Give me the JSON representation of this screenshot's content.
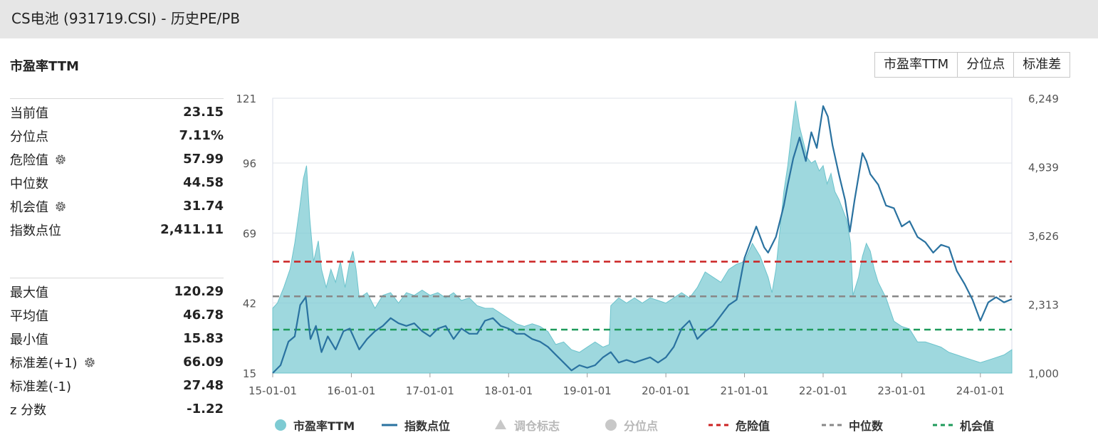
{
  "header": {
    "title": "CS电池 (931719.CSI) - 历史PE/PB"
  },
  "section": {
    "title": "市盈率TTM"
  },
  "tabs": [
    {
      "label": "市盈率TTM"
    },
    {
      "label": "分位点"
    },
    {
      "label": "标准差"
    }
  ],
  "stats_top": [
    {
      "label": "当前值",
      "value": "23.15",
      "gear": false
    },
    {
      "label": "分位点",
      "value": "7.11%",
      "gear": false
    },
    {
      "label": "危险值",
      "value": "57.99",
      "gear": true
    },
    {
      "label": "中位数",
      "value": "44.58",
      "gear": false
    },
    {
      "label": "机会值",
      "value": "31.74",
      "gear": true
    },
    {
      "label": "指数点位",
      "value": "2,411.11",
      "gear": false
    }
  ],
  "stats_bottom": [
    {
      "label": "最大值",
      "value": "120.29",
      "gear": false
    },
    {
      "label": "平均值",
      "value": "46.78",
      "gear": false
    },
    {
      "label": "最小值",
      "value": "15.83",
      "gear": false
    },
    {
      "label": "标准差(+1)",
      "value": "66.09",
      "gear": true
    },
    {
      "label": "标准差(-1)",
      "value": "27.48",
      "gear": false
    },
    {
      "label": "z 分数",
      "value": "-1.22",
      "gear": false
    }
  ],
  "legend": [
    {
      "label": "市盈率TTM",
      "marker": "circle",
      "color": "#7ecbd3",
      "active": true
    },
    {
      "label": "指数点位",
      "marker": "line",
      "color": "#2a72a0",
      "active": true
    },
    {
      "label": "调仓标志",
      "marker": "triangle",
      "color": "#c8c8c8",
      "active": false
    },
    {
      "label": "分位点",
      "marker": "circle",
      "color": "#c8c8c8",
      "active": false
    },
    {
      "label": "危险值",
      "marker": "dash",
      "color": "#cc2222",
      "active": true
    },
    {
      "label": "中位数",
      "marker": "dash",
      "color": "#888888",
      "active": true
    },
    {
      "label": "机会值",
      "marker": "dash",
      "color": "#1e9a5a",
      "active": true
    }
  ],
  "chart_data": {
    "type": "area",
    "x_tick_labels": [
      "15-01-01",
      "16-01-01",
      "17-01-01",
      "18-01-01",
      "19-01-01",
      "20-01-01",
      "21-01-01",
      "22-01-01",
      "23-01-01",
      "24-01-01"
    ],
    "y_left": {
      "ticks": [
        "121",
        "96",
        "69",
        "42",
        "15"
      ],
      "tick_values": [
        121,
        96,
        69,
        42,
        15
      ],
      "range": [
        15,
        121
      ]
    },
    "y_right": {
      "ticks": [
        "6,249",
        "4,939",
        "3,626",
        "2,313",
        "1,000"
      ],
      "tick_values": [
        6249,
        4939,
        3626,
        2313,
        1000
      ],
      "range": [
        1000,
        6249
      ]
    },
    "x_range": [
      2015.0,
      2024.4
    ],
    "reference_lines": [
      {
        "name": "危险值",
        "value": 57.99,
        "color": "#cc2222"
      },
      {
        "name": "中位数",
        "value": 44.58,
        "color": "#888888"
      },
      {
        "name": "机会值",
        "value": 31.74,
        "color": "#1e9a5a"
      }
    ],
    "series": [
      {
        "name": "市盈率TTM",
        "axis": "left",
        "kind": "area",
        "color": "#7ecbd3",
        "points": [
          [
            2015.0,
            40
          ],
          [
            2015.06,
            42
          ],
          [
            2015.14,
            48
          ],
          [
            2015.22,
            55
          ],
          [
            2015.28,
            65
          ],
          [
            2015.34,
            78
          ],
          [
            2015.39,
            90
          ],
          [
            2015.43,
            95
          ],
          [
            2015.47,
            75
          ],
          [
            2015.52,
            58
          ],
          [
            2015.58,
            66
          ],
          [
            2015.62,
            55
          ],
          [
            2015.68,
            48
          ],
          [
            2015.74,
            55
          ],
          [
            2015.8,
            50
          ],
          [
            2015.86,
            58
          ],
          [
            2015.92,
            48
          ],
          [
            2015.98,
            58
          ],
          [
            2016.02,
            62
          ],
          [
            2016.06,
            55
          ],
          [
            2016.1,
            44
          ],
          [
            2016.2,
            46
          ],
          [
            2016.3,
            40
          ],
          [
            2016.4,
            45
          ],
          [
            2016.5,
            46
          ],
          [
            2016.6,
            42
          ],
          [
            2016.7,
            46
          ],
          [
            2016.8,
            45
          ],
          [
            2016.9,
            47
          ],
          [
            2017.0,
            45
          ],
          [
            2017.1,
            46
          ],
          [
            2017.2,
            44
          ],
          [
            2017.3,
            46
          ],
          [
            2017.4,
            43
          ],
          [
            2017.5,
            44
          ],
          [
            2017.6,
            41
          ],
          [
            2017.7,
            40
          ],
          [
            2017.8,
            40
          ],
          [
            2017.9,
            38
          ],
          [
            2018.0,
            36
          ],
          [
            2018.1,
            34
          ],
          [
            2018.2,
            33
          ],
          [
            2018.3,
            34
          ],
          [
            2018.4,
            33
          ],
          [
            2018.5,
            31
          ],
          [
            2018.6,
            26
          ],
          [
            2018.7,
            27
          ],
          [
            2018.8,
            24
          ],
          [
            2018.9,
            23
          ],
          [
            2019.0,
            25
          ],
          [
            2019.1,
            27
          ],
          [
            2019.2,
            25
          ],
          [
            2019.28,
            26
          ],
          [
            2019.3,
            41
          ],
          [
            2019.4,
            44
          ],
          [
            2019.5,
            42
          ],
          [
            2019.6,
            44
          ],
          [
            2019.7,
            42
          ],
          [
            2019.8,
            44
          ],
          [
            2019.9,
            43
          ],
          [
            2020.0,
            42
          ],
          [
            2020.1,
            44
          ],
          [
            2020.2,
            46
          ],
          [
            2020.3,
            44
          ],
          [
            2020.4,
            48
          ],
          [
            2020.5,
            54
          ],
          [
            2020.6,
            52
          ],
          [
            2020.7,
            50
          ],
          [
            2020.8,
            55
          ],
          [
            2020.9,
            57
          ],
          [
            2021.0,
            58
          ],
          [
            2021.1,
            65
          ],
          [
            2021.2,
            60
          ],
          [
            2021.3,
            52
          ],
          [
            2021.35,
            46
          ],
          [
            2021.4,
            55
          ],
          [
            2021.45,
            70
          ],
          [
            2021.5,
            85
          ],
          [
            2021.55,
            95
          ],
          [
            2021.6,
            108
          ],
          [
            2021.65,
            120
          ],
          [
            2021.7,
            110
          ],
          [
            2021.75,
            104
          ],
          [
            2021.8,
            98
          ],
          [
            2021.85,
            96
          ],
          [
            2021.9,
            97
          ],
          [
            2021.95,
            93
          ],
          [
            2022.0,
            95
          ],
          [
            2022.05,
            88
          ],
          [
            2022.1,
            92
          ],
          [
            2022.15,
            85
          ],
          [
            2022.2,
            82
          ],
          [
            2022.25,
            78
          ],
          [
            2022.3,
            74
          ],
          [
            2022.35,
            65
          ],
          [
            2022.38,
            45
          ],
          [
            2022.45,
            52
          ],
          [
            2022.5,
            60
          ],
          [
            2022.55,
            65
          ],
          [
            2022.6,
            62
          ],
          [
            2022.65,
            55
          ],
          [
            2022.7,
            50
          ],
          [
            2022.8,
            44
          ],
          [
            2022.9,
            35
          ],
          [
            2023.0,
            33
          ],
          [
            2023.1,
            32
          ],
          [
            2023.2,
            27
          ],
          [
            2023.3,
            27
          ],
          [
            2023.4,
            26
          ],
          [
            2023.5,
            25
          ],
          [
            2023.6,
            23
          ],
          [
            2023.7,
            22
          ],
          [
            2023.8,
            21
          ],
          [
            2023.9,
            20
          ],
          [
            2024.0,
            19
          ],
          [
            2024.1,
            20
          ],
          [
            2024.2,
            21
          ],
          [
            2024.3,
            22
          ],
          [
            2024.4,
            24
          ]
        ]
      },
      {
        "name": "指数点位",
        "axis": "right",
        "kind": "line",
        "color": "#2a72a0",
        "points": [
          [
            2015.0,
            1000
          ],
          [
            2015.1,
            1150
          ],
          [
            2015.2,
            1600
          ],
          [
            2015.28,
            1700
          ],
          [
            2015.35,
            2300
          ],
          [
            2015.42,
            2450
          ],
          [
            2015.48,
            1650
          ],
          [
            2015.55,
            1900
          ],
          [
            2015.62,
            1400
          ],
          [
            2015.7,
            1700
          ],
          [
            2015.8,
            1450
          ],
          [
            2015.9,
            1800
          ],
          [
            2015.98,
            1850
          ],
          [
            2016.1,
            1450
          ],
          [
            2016.2,
            1650
          ],
          [
            2016.3,
            1800
          ],
          [
            2016.4,
            1900
          ],
          [
            2016.5,
            2050
          ],
          [
            2016.6,
            1950
          ],
          [
            2016.7,
            1900
          ],
          [
            2016.8,
            1950
          ],
          [
            2016.9,
            1800
          ],
          [
            2017.0,
            1700
          ],
          [
            2017.1,
            1850
          ],
          [
            2017.2,
            1900
          ],
          [
            2017.3,
            1650
          ],
          [
            2017.4,
            1850
          ],
          [
            2017.5,
            1750
          ],
          [
            2017.6,
            1750
          ],
          [
            2017.7,
            2000
          ],
          [
            2017.8,
            2050
          ],
          [
            2017.9,
            1900
          ],
          [
            2018.0,
            1850
          ],
          [
            2018.1,
            1750
          ],
          [
            2018.2,
            1750
          ],
          [
            2018.3,
            1650
          ],
          [
            2018.4,
            1600
          ],
          [
            2018.5,
            1500
          ],
          [
            2018.6,
            1350
          ],
          [
            2018.7,
            1200
          ],
          [
            2018.8,
            1050
          ],
          [
            2018.9,
            1150
          ],
          [
            2019.0,
            1100
          ],
          [
            2019.1,
            1150
          ],
          [
            2019.2,
            1300
          ],
          [
            2019.3,
            1400
          ],
          [
            2019.4,
            1200
          ],
          [
            2019.5,
            1250
          ],
          [
            2019.6,
            1200
          ],
          [
            2019.7,
            1250
          ],
          [
            2019.8,
            1300
          ],
          [
            2019.9,
            1200
          ],
          [
            2020.0,
            1300
          ],
          [
            2020.1,
            1500
          ],
          [
            2020.2,
            1850
          ],
          [
            2020.3,
            2000
          ],
          [
            2020.4,
            1650
          ],
          [
            2020.5,
            1800
          ],
          [
            2020.6,
            1900
          ],
          [
            2020.7,
            2100
          ],
          [
            2020.8,
            2300
          ],
          [
            2020.9,
            2400
          ],
          [
            2021.0,
            3200
          ],
          [
            2021.1,
            3600
          ],
          [
            2021.15,
            3800
          ],
          [
            2021.25,
            3400
          ],
          [
            2021.3,
            3300
          ],
          [
            2021.4,
            3600
          ],
          [
            2021.5,
            4200
          ],
          [
            2021.55,
            4600
          ],
          [
            2021.62,
            5100
          ],
          [
            2021.7,
            5500
          ],
          [
            2021.78,
            5050
          ],
          [
            2021.85,
            5600
          ],
          [
            2021.92,
            5300
          ],
          [
            2022.0,
            6100
          ],
          [
            2022.06,
            5900
          ],
          [
            2022.12,
            5350
          ],
          [
            2022.2,
            4800
          ],
          [
            2022.28,
            4300
          ],
          [
            2022.34,
            3700
          ],
          [
            2022.4,
            4300
          ],
          [
            2022.5,
            5200
          ],
          [
            2022.55,
            5050
          ],
          [
            2022.6,
            4800
          ],
          [
            2022.7,
            4600
          ],
          [
            2022.8,
            4200
          ],
          [
            2022.9,
            4150
          ],
          [
            2023.0,
            3800
          ],
          [
            2023.1,
            3900
          ],
          [
            2023.2,
            3600
          ],
          [
            2023.3,
            3500
          ],
          [
            2023.4,
            3300
          ],
          [
            2023.5,
            3450
          ],
          [
            2023.6,
            3400
          ],
          [
            2023.7,
            2950
          ],
          [
            2023.8,
            2700
          ],
          [
            2023.9,
            2400
          ],
          [
            2024.0,
            2000
          ],
          [
            2024.1,
            2350
          ],
          [
            2024.2,
            2450
          ],
          [
            2024.3,
            2350
          ],
          [
            2024.4,
            2411
          ]
        ]
      }
    ]
  }
}
